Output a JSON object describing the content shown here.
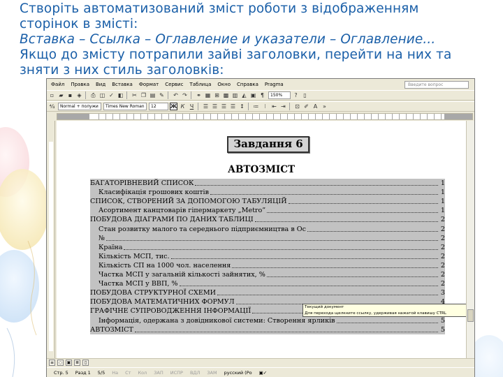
{
  "instruction": {
    "line1": "Створіть автоматизований зміст роботи з відображенням",
    "line2": "сторінок в змісті:",
    "line3": "Вставка – Ссылка – Оглавление и указатели – Оглавление...",
    "line4": "Якщо до змісту потрапили зайві заголовки, перейти на них та",
    "line5": "зняти з них стиль заголовків:"
  },
  "word": {
    "menu": [
      "Файл",
      "Правка",
      "Вид",
      "Вставка",
      "Формат",
      "Сервис",
      "Таблица",
      "Окно",
      "Справка",
      "Pragma"
    ],
    "help_placeholder": "Введите вопрос",
    "zoom": "150%",
    "style_combo": "Normal + полужи",
    "font_combo": "Times New Roman",
    "size_combo": "12",
    "bold_label": "Ж",
    "italic_label": "К",
    "underline_label": "Ч",
    "document": {
      "task_title": "Завдання 6",
      "toc_heading": "АВТОЗМІСТ",
      "toc": [
        {
          "text": "БАГАТОРІВНЕВИЙ СПИСОК",
          "page": "1",
          "level": 1
        },
        {
          "text": "Класифікація грошових коштів",
          "page": "1",
          "level": 2
        },
        {
          "text": "СПИСОК, СТВОРЕНИЙ ЗА ДОПОМОГОЮ ТАБУЛЯЦІЙ",
          "page": "1",
          "level": 1
        },
        {
          "text": "Асортимент  канцтоварів гіпермаркету „Metro”",
          "page": "1",
          "level": 2
        },
        {
          "text": "ПОБУДОВА ДІАГРАМИ ПО ДАНИХ ТАБЛИЦІ",
          "page": "2",
          "level": 1
        },
        {
          "text": "Стан розвитку малого та середнього підприємництва в Ос",
          "page": "2",
          "level": 2
        },
        {
          "text": "№",
          "page": "2",
          "level": 2
        },
        {
          "text": "Країна",
          "page": "2",
          "level": 2
        },
        {
          "text": "Кількість МСП, тис.",
          "page": "2",
          "level": 2
        },
        {
          "text": "Кількість СП на 1000 чол. населення",
          "page": "2",
          "level": 2
        },
        {
          "text": "Частка МСП у загальній кількості зайнятих, %",
          "page": "2",
          "level": 2
        },
        {
          "text": "Частка МСП у ВВП, %",
          "page": "2",
          "level": 2
        },
        {
          "text": "ПОБУДОВА СТРУКТУРНОЇ СХЕМИ",
          "page": "3",
          "level": 1
        },
        {
          "text": "ПОБУДОВА МАТЕМАТИЧНИХ ФОРМУЛ",
          "page": "4",
          "level": 1
        },
        {
          "text": "ГРАФІЧНЕ СУПРОВОДЖЕННЯ ІНФОРМАЦІЇ",
          "page": "5",
          "level": 1
        },
        {
          "text": "Інформація, одержана з довідникової системи: Створення ярликів",
          "page": "5",
          "level": 2
        },
        {
          "text": "АВТОЗМІСТ",
          "page": "5",
          "level": 1
        }
      ],
      "tooltip_line1": "Текущий документ",
      "tooltip_line2": "Для перехода щелкните ссылку, удерживая нажатой клавишу CTRL"
    },
    "status": {
      "page": "Стр.  5",
      "section": "Разд  1",
      "pages": "5/5",
      "at": "На",
      "line": "Ст",
      "col": "Кол",
      "rec": "ЗАП",
      "trk": "ИСПР",
      "ext": "ВДЛ",
      "ovr": "ЗАМ",
      "lang": "русский (Ро"
    }
  }
}
